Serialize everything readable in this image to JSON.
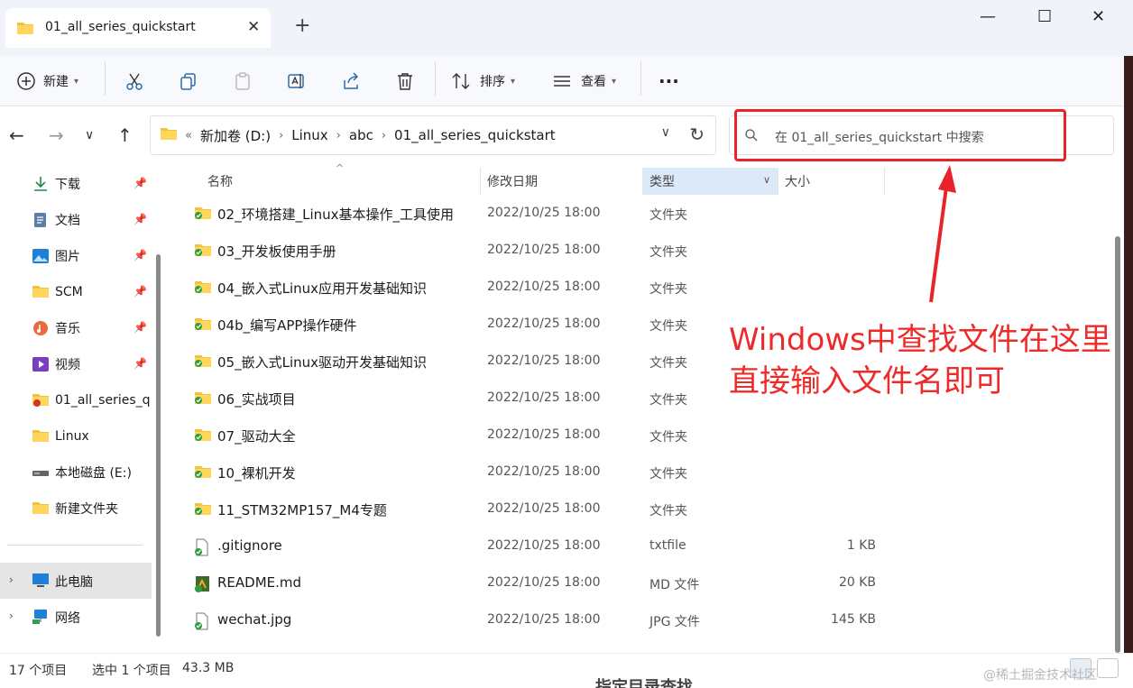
{
  "tab": {
    "title": "01_all_series_quickstart",
    "close": "✕",
    "new": "+"
  },
  "window": {
    "minimize": "—",
    "maximize": "☐",
    "close": "✕"
  },
  "toolbar": {
    "new_label": "新建",
    "sort_label": "排序",
    "view_label": "查看",
    "more": "···"
  },
  "address": {
    "overflow": "«",
    "crumbs": [
      "新加卷 (D:)",
      "Linux",
      "abc",
      "01_all_series_quickstart"
    ]
  },
  "search": {
    "placeholder": "在 01_all_series_quickstart 中搜索"
  },
  "sidebar": {
    "items": [
      {
        "label": "下载",
        "icon": "download-icon",
        "pinned": true
      },
      {
        "label": "文档",
        "icon": "documents-icon",
        "pinned": true
      },
      {
        "label": "图片",
        "icon": "pictures-icon",
        "pinned": true
      },
      {
        "label": "SCM",
        "icon": "folder-icon",
        "pinned": true
      },
      {
        "label": "音乐",
        "icon": "music-icon",
        "pinned": true
      },
      {
        "label": "视频",
        "icon": "videos-icon",
        "pinned": true
      },
      {
        "label": "01_all_series_q",
        "icon": "folder-icon",
        "pinned": false
      },
      {
        "label": "Linux",
        "icon": "folder-icon",
        "pinned": false
      },
      {
        "label": "本地磁盘 (E:)",
        "icon": "drive-icon",
        "pinned": false
      },
      {
        "label": "新建文件夹",
        "icon": "folder-icon",
        "pinned": false
      }
    ],
    "this_pc": "此电脑",
    "network": "网络"
  },
  "columns": {
    "name": "名称",
    "date": "修改日期",
    "type": "类型",
    "size": "大小"
  },
  "files": [
    {
      "name": "02_环境搭建_Linux基本操作_工具使用",
      "date": "2022/10/25 18:00",
      "type": "文件夹",
      "size": "",
      "kind": "folder"
    },
    {
      "name": "03_开发板使用手册",
      "date": "2022/10/25 18:00",
      "type": "文件夹",
      "size": "",
      "kind": "folder"
    },
    {
      "name": "04_嵌入式Linux应用开发基础知识",
      "date": "2022/10/25 18:00",
      "type": "文件夹",
      "size": "",
      "kind": "folder"
    },
    {
      "name": "04b_编写APP操作硬件",
      "date": "2022/10/25 18:00",
      "type": "文件夹",
      "size": "",
      "kind": "folder"
    },
    {
      "name": "05_嵌入式Linux驱动开发基础知识",
      "date": "2022/10/25 18:00",
      "type": "文件夹",
      "size": "",
      "kind": "folder"
    },
    {
      "name": "06_实战项目",
      "date": "2022/10/25 18:00",
      "type": "文件夹",
      "size": "",
      "kind": "folder"
    },
    {
      "name": "07_驱动大全",
      "date": "2022/10/25 18:00",
      "type": "文件夹",
      "size": "",
      "kind": "folder"
    },
    {
      "name": "10_裸机开发",
      "date": "2022/10/25 18:00",
      "type": "文件夹",
      "size": "",
      "kind": "folder"
    },
    {
      "name": "11_STM32MP157_M4专题",
      "date": "2022/10/25 18:00",
      "type": "文件夹",
      "size": "",
      "kind": "folder"
    },
    {
      "name": ".gitignore",
      "date": "2022/10/25 18:00",
      "type": "txtfile",
      "size": "1 KB",
      "kind": "file"
    },
    {
      "name": "README.md",
      "date": "2022/10/25 18:00",
      "type": "MD 文件",
      "size": "20 KB",
      "kind": "md"
    },
    {
      "name": "wechat.jpg",
      "date": "2022/10/25 18:00",
      "type": "JPG 文件",
      "size": "145 KB",
      "kind": "file"
    }
  ],
  "status": {
    "count": "17 个项目",
    "selected": "选中 1 个项目",
    "size": "43.3 MB"
  },
  "annotation": {
    "line1": "Windows中查找文件在这里",
    "line2": "直接输入文件名即可",
    "color": "#ee2a2a"
  },
  "watermark": "@稀土掘金技术社区",
  "bottom_text": "指定目录查找"
}
